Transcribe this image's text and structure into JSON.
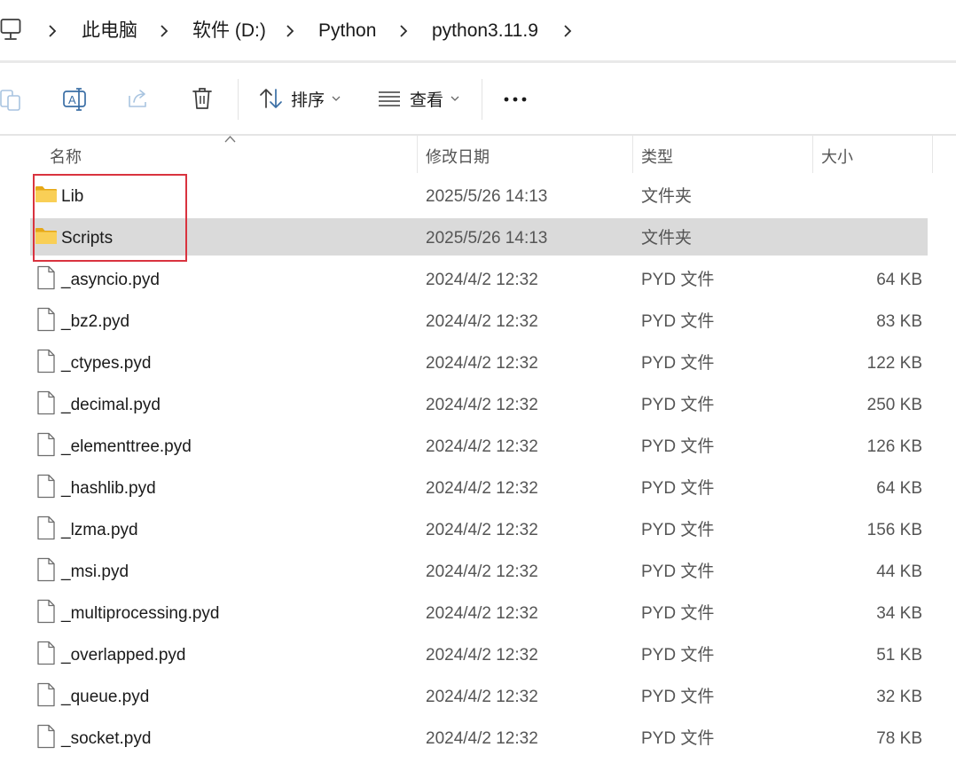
{
  "breadcrumb": {
    "items": [
      "此电脑",
      "软件 (D:)",
      "Python",
      "python3.11.9"
    ]
  },
  "toolbar": {
    "sort_label": "排序",
    "view_label": "查看"
  },
  "columns": {
    "name": "名称",
    "modified": "修改日期",
    "type": "类型",
    "size": "大小"
  },
  "files": [
    {
      "name": "Lib",
      "modified": "2025/5/26 14:13",
      "type": "文件夹",
      "size": "",
      "kind": "folder"
    },
    {
      "name": "Scripts",
      "modified": "2025/5/26 14:13",
      "type": "文件夹",
      "size": "",
      "kind": "folder",
      "selected": true
    },
    {
      "name": "_asyncio.pyd",
      "modified": "2024/4/2 12:32",
      "type": "PYD 文件",
      "size": "64 KB",
      "kind": "file"
    },
    {
      "name": "_bz2.pyd",
      "modified": "2024/4/2 12:32",
      "type": "PYD 文件",
      "size": "83 KB",
      "kind": "file"
    },
    {
      "name": "_ctypes.pyd",
      "modified": "2024/4/2 12:32",
      "type": "PYD 文件",
      "size": "122 KB",
      "kind": "file"
    },
    {
      "name": "_decimal.pyd",
      "modified": "2024/4/2 12:32",
      "type": "PYD 文件",
      "size": "250 KB",
      "kind": "file"
    },
    {
      "name": "_elementtree.pyd",
      "modified": "2024/4/2 12:32",
      "type": "PYD 文件",
      "size": "126 KB",
      "kind": "file"
    },
    {
      "name": "_hashlib.pyd",
      "modified": "2024/4/2 12:32",
      "type": "PYD 文件",
      "size": "64 KB",
      "kind": "file"
    },
    {
      "name": "_lzma.pyd",
      "modified": "2024/4/2 12:32",
      "type": "PYD 文件",
      "size": "156 KB",
      "kind": "file"
    },
    {
      "name": "_msi.pyd",
      "modified": "2024/4/2 12:32",
      "type": "PYD 文件",
      "size": "44 KB",
      "kind": "file"
    },
    {
      "name": "_multiprocessing.pyd",
      "modified": "2024/4/2 12:32",
      "type": "PYD 文件",
      "size": "34 KB",
      "kind": "file"
    },
    {
      "name": "_overlapped.pyd",
      "modified": "2024/4/2 12:32",
      "type": "PYD 文件",
      "size": "51 KB",
      "kind": "file"
    },
    {
      "name": "_queue.pyd",
      "modified": "2024/4/2 12:32",
      "type": "PYD 文件",
      "size": "32 KB",
      "kind": "file"
    },
    {
      "name": "_socket.pyd",
      "modified": "2024/4/2 12:32",
      "type": "PYD 文件",
      "size": "78 KB",
      "kind": "file"
    }
  ],
  "icons": {
    "computer": "computer-icon",
    "chevron": "chevron-right-icon",
    "paste": "paste-icon",
    "rename": "rename-icon",
    "share": "share-icon",
    "delete": "delete-icon",
    "sort": "sort-icon",
    "view": "view-icon",
    "more": "more-icon",
    "folder": "folder-icon",
    "file": "file-icon"
  },
  "colors": {
    "selection": "#dadada",
    "highlight_box": "#d9333f",
    "folder": "#f5c342"
  }
}
